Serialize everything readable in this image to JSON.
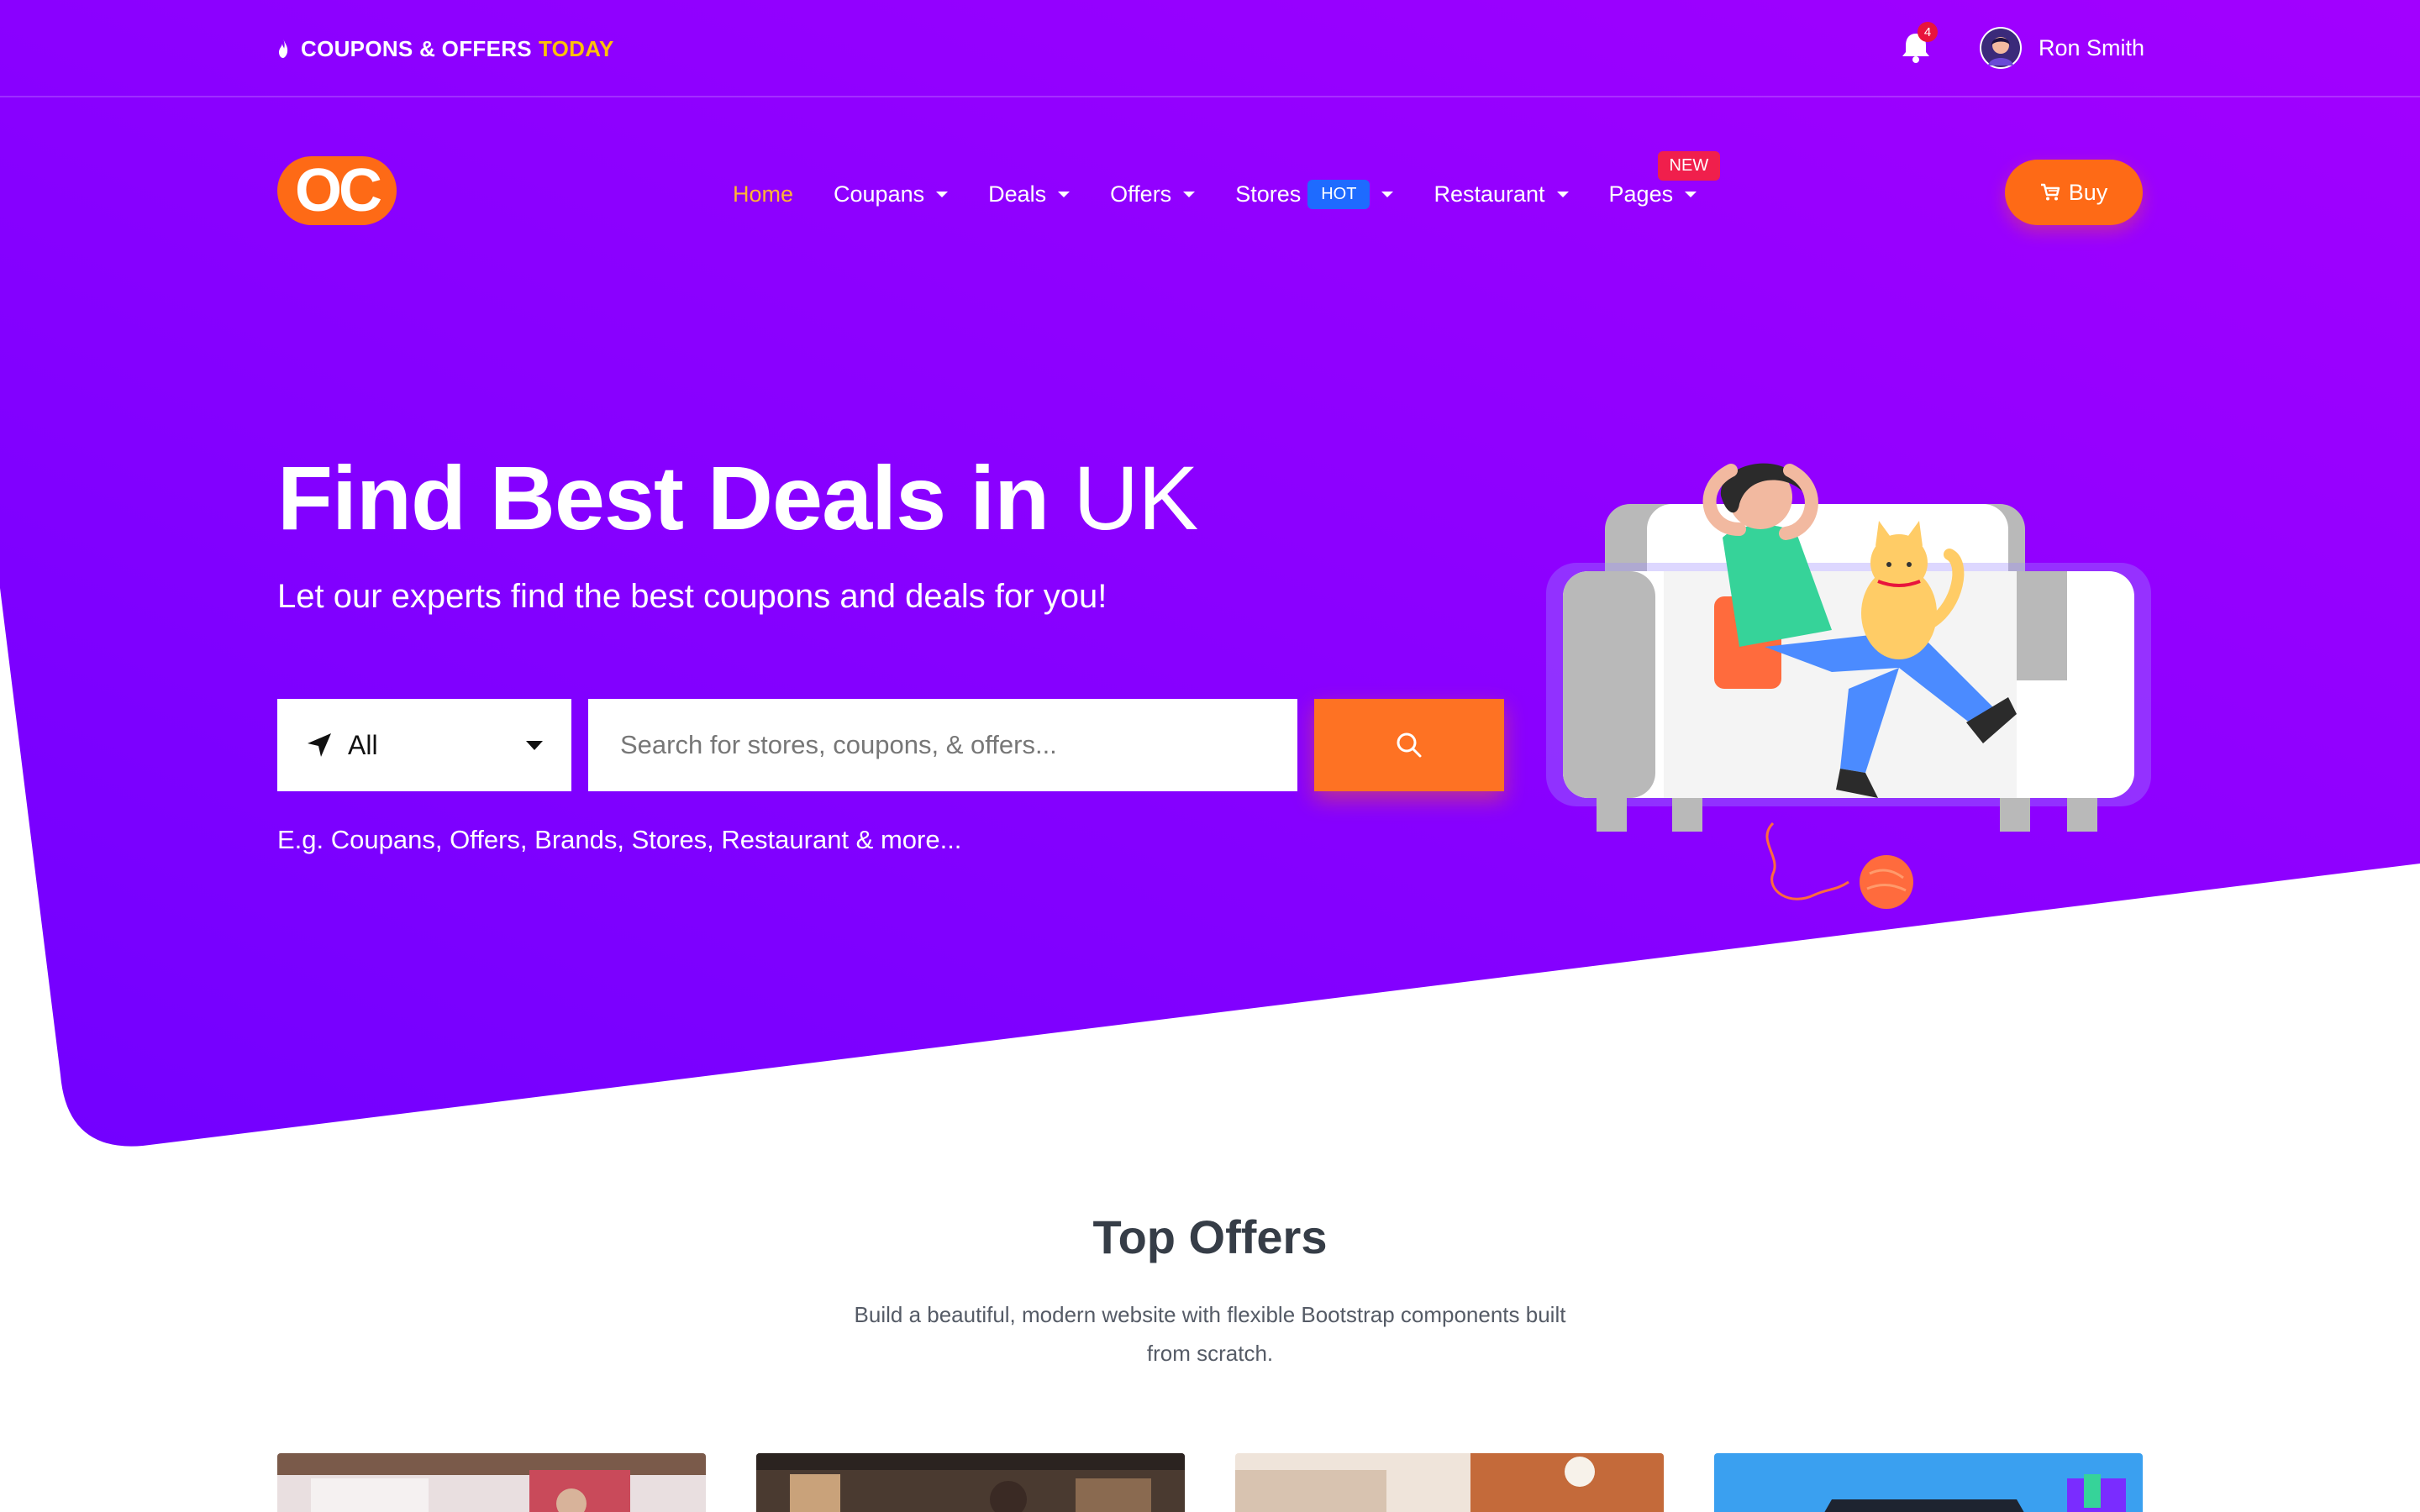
{
  "topbar": {
    "promo_text": "COUPONS & OFFERS",
    "promo_highlight": "TODAY",
    "notification_count": "4",
    "user_name": "Ron Smith"
  },
  "brand": {
    "logo_text": "OC",
    "accent_color": "#fe6a16",
    "hero_gradient": [
      "#7a00ff",
      "#a100ff"
    ]
  },
  "nav": {
    "items": [
      {
        "label": "Home",
        "active": true
      },
      {
        "label": "Coupans"
      },
      {
        "label": "Deals"
      },
      {
        "label": "Offers"
      },
      {
        "label": "Stores",
        "badge": "HOT"
      },
      {
        "label": "Restaurant"
      },
      {
        "label": "Pages",
        "badge": "NEW"
      }
    ],
    "buy_label": "Buy"
  },
  "hero": {
    "headline_bold": "Find Best Deals in",
    "headline_light": "UK",
    "subheadline": "Let our experts find the best coupons and deals for you!",
    "location_value": "All",
    "search_placeholder": "Search for stores, coupons, & offers...",
    "hint": "E.g. Coupans, Offers, Brands, Stores, Restaurant & more..."
  },
  "top_offers": {
    "title": "Top Offers",
    "subtitle": "Build a beautiful, modern website with flexible Bootstrap components built from scratch."
  },
  "icons": [
    "fire-icon",
    "bell-icon",
    "cart-icon",
    "location-arrow-icon",
    "search-icon",
    "chevron-down-icon"
  ]
}
